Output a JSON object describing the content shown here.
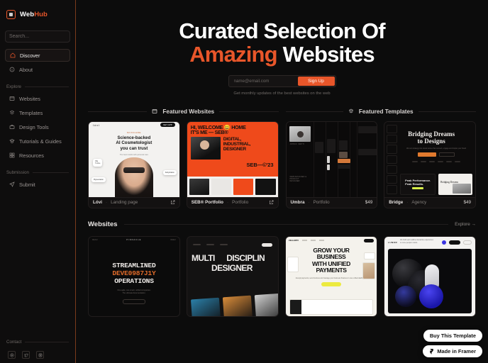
{
  "brand": {
    "name_first": "Web",
    "name_second": "Hub",
    "logo_icon": "square-logo-icon"
  },
  "sidebar": {
    "search_placeholder": "Search...",
    "primary": [
      {
        "label": "Discover",
        "icon": "home-icon",
        "active": true
      },
      {
        "label": "About",
        "icon": "info-icon",
        "active": false
      }
    ],
    "explore_label": "Explore",
    "explore_items": [
      {
        "label": "Websites",
        "icon": "browser-icon"
      },
      {
        "label": "Templates",
        "icon": "layout-icon"
      },
      {
        "label": "Design Tools",
        "icon": "toolbox-icon"
      },
      {
        "label": "Tutorials & Guides",
        "icon": "graduation-cap-icon"
      },
      {
        "label": "Resources",
        "icon": "grid-icon"
      }
    ],
    "submission_label": "Submission",
    "submission_items": [
      {
        "label": "Submit",
        "icon": "send-icon"
      }
    ],
    "contact_label": "Contact",
    "socials": [
      {
        "name": "email-icon"
      },
      {
        "name": "twitter-icon"
      },
      {
        "name": "instagram-icon"
      }
    ]
  },
  "hero": {
    "line1": "Curated Selection Of",
    "line2_accent": "Amazing",
    "line2_rest": "Websites",
    "email_placeholder": "name@email.com",
    "email_value": "",
    "signup_label": "Sign Up",
    "subtext": "Get monthly updates of the best websites on the web",
    "accent_color": "#e8562a"
  },
  "featured_websites": {
    "title": "Featured Websites",
    "icon": "browser-icon",
    "cards": [
      {
        "name": "Lóvi",
        "separator": "·",
        "category": "Landing page",
        "link_icon": "external-link-icon",
        "preview": {
          "logo": "lóvi",
          "pill": "GET APP",
          "eyebrow": "SKINCARE",
          "headline": "Science-backed\nAI Cosmetologist\nyou can trust",
          "sub": "The best results with personal care",
          "tags": [
            "Oily\nT-zone",
            "Dehydration",
            "Pigmentation",
            "Fine lines"
          ]
        }
      },
      {
        "name": "SEB® Portfolio",
        "separator": "·",
        "category": "Portfolio",
        "link_icon": "external-link-icon",
        "preview": {
          "line1": "HI, WELCOME 😀 HOME",
          "line2": "IT'S ME — SEB®",
          "words": "DIGITAL,\nINDUSTRIAL,\nDESIGNER",
          "signature": "SEB—©'23"
        }
      }
    ]
  },
  "featured_templates": {
    "title": "Featured Templates",
    "icon": "template-icon",
    "cards": [
      {
        "name": "Umbra",
        "separator": "·",
        "category": "Portfolio",
        "price": "$49",
        "preview": {
          "author": "JOHN R. SMITH",
          "note": "WEB DESIGNER & PRODUCT DESIGNER"
        }
      },
      {
        "name": "Bridge",
        "separator": "·",
        "category": "Agency",
        "price": "$49",
        "preview": {
          "headline": "Bridging Dreams\nto Designs",
          "sub": "We turn strategy into visual stories that connect, engage and inspire your brand",
          "cta_primary": "Get Started",
          "cta_secondary": "Subscribe",
          "promo": "Peak Performance.\nPeak Results.",
          "article": "Bridging Dreams"
        }
      }
    ]
  },
  "websites_section": {
    "title": "Websites",
    "explore_label": "Explore →",
    "cards": [
      {
        "name": "pinnacle-streamlined-operations",
        "preview": {
          "logo": "PINNACLE",
          "nav_left": "MENU",
          "nav_right": "INDEX",
          "line1": "STREAMLINED",
          "line2": "DEVE0987J1Y",
          "line3": "OPERATIONS",
          "sub": "One agile, one smart, unified companies.\nThe ultimate documentation.",
          "cta": "TAKE OUR 1-1"
        }
      },
      {
        "name": "multi-disciplinary-designer",
        "preview": {
          "line1": "MULTI",
          "line1b": "DISCIPLIN",
          "line2": "DESIGNER"
        }
      },
      {
        "name": "unified-payments",
        "preview": {
          "logo": "ZELLEPAY",
          "headline": "GROW YOUR\nBUSINESS\nWITH UNIFIED\nPAYMENTS",
          "sub": "Accept payments, send invoices and manage your business finances in one unified dashboard.",
          "cta": "FINISH NOW"
        }
      },
      {
        "name": "lunor-3d-studio",
        "preview": {
          "logo": "LUNOR",
          "tagline": "We build epic realtime interactive experiences to move people's minds."
        }
      }
    ]
  },
  "floating_badges": [
    {
      "label": "Buy This Template",
      "icon": null
    },
    {
      "label": "Made in Framer",
      "icon": "framer-icon"
    }
  ]
}
